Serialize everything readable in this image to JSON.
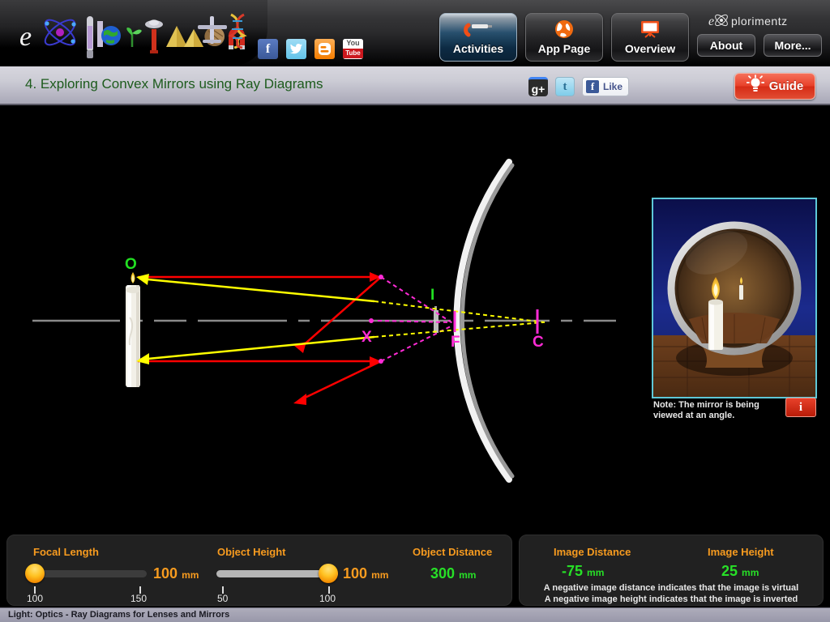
{
  "nav": {
    "brand_logo": "explorimentz-logo",
    "social": [
      {
        "name": "facebook-icon",
        "label": "f"
      },
      {
        "name": "twitter-icon",
        "label": "t"
      },
      {
        "name": "blogger-icon",
        "label": "B"
      },
      {
        "name": "youtube-icon",
        "label_top": "You",
        "label_bottom": "Tube"
      }
    ],
    "buttons": [
      {
        "label": "Activities",
        "icon": "microscope-icon",
        "active": true
      },
      {
        "label": "App Page",
        "icon": "globe-icon",
        "active": false
      },
      {
        "label": "Overview",
        "icon": "presentation-board-icon",
        "active": false
      }
    ],
    "small_buttons": [
      {
        "label": "About"
      },
      {
        "label": "More..."
      }
    ],
    "brand_top_right": "eXplorimentz"
  },
  "title": {
    "text": "4. Exploring Convex Mirrors using Ray Diagrams",
    "color": "#1d5b1d"
  },
  "share": {
    "gplus_label": "g+",
    "twitter_label": "t",
    "facebook_like_label": "Like",
    "guide_label": "Guide",
    "guide_icon": "lightbulb-icon"
  },
  "diagram": {
    "labels": {
      "object": "O",
      "image": "I",
      "focus": "F",
      "center": "C",
      "vertex": "X"
    },
    "colors": {
      "object_label": "#22e022",
      "image_label": "#22e022",
      "focus_label": "#ff2bd6",
      "center_label": "#ff2bd6",
      "vertex_label": "#ff2bd6",
      "incident_ray": "#ff0000",
      "reflected_ray": "#ffff00",
      "virtual_ray": "#ff2bd6",
      "mirror": "#d8d8d8",
      "axis": "#888888"
    }
  },
  "inset": {
    "note": "Note: The mirror is being viewed at an angle.",
    "info_label": "i",
    "border_color": "#5ec8d8"
  },
  "controls": {
    "focal_length": {
      "title": "Focal Length",
      "value": "100",
      "unit": "mm",
      "min_label": "100",
      "max_label": "150",
      "fill": 0
    },
    "object_height": {
      "title": "Object Height",
      "value": "100",
      "unit": "mm",
      "min_label": "50",
      "max_label": "100",
      "fill": 100
    },
    "object_distance": {
      "title": "Object Distance",
      "value": "300",
      "unit": "mm"
    }
  },
  "results": {
    "image_distance": {
      "title": "Image Distance",
      "value": "-75",
      "unit": "mm"
    },
    "image_height": {
      "title": "Image Height",
      "value": "25",
      "unit": "mm"
    },
    "note_line1": "A negative image distance indicates that the image is virtual",
    "note_line2": "A negative image height indicates that the image is inverted"
  },
  "statusbar": {
    "text": "Light: Optics - Ray Diagrams for Lenses and Mirrors"
  }
}
